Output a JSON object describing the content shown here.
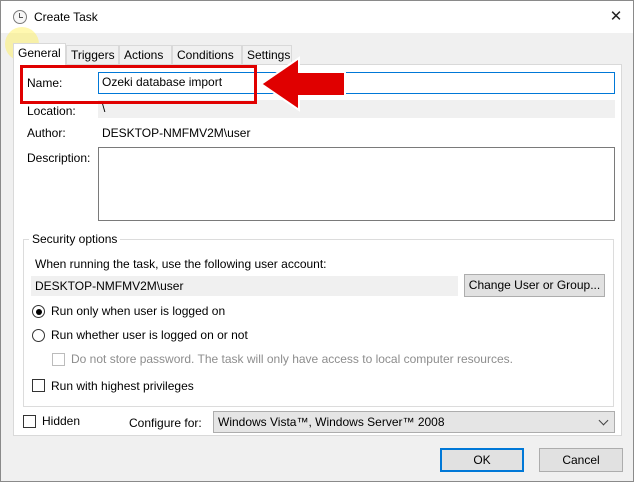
{
  "window": {
    "title": "Create Task",
    "close_label": "✕"
  },
  "tabs": [
    {
      "label": "General",
      "active": true
    },
    {
      "label": "Triggers",
      "active": false
    },
    {
      "label": "Actions",
      "active": false
    },
    {
      "label": "Conditions",
      "active": false
    },
    {
      "label": "Settings",
      "active": false
    }
  ],
  "general": {
    "name_label": "Name:",
    "name_value": "Ozeki database import",
    "location_label": "Location:",
    "location_value": "\\",
    "author_label": "Author:",
    "author_value": "DESKTOP-NMFMV2M\\user",
    "description_label": "Description:",
    "description_value": ""
  },
  "security": {
    "legend": "Security options",
    "account_prompt": "When running the task, use the following user account:",
    "account_value": "DESKTOP-NMFMV2M\\user",
    "change_button": "Change User or Group...",
    "radio_logged_on": "Run only when user is logged on",
    "radio_logged_on_checked": true,
    "radio_whether": "Run whether user is logged on or not",
    "radio_whether_checked": false,
    "no_store_password": "Do not store password.  The task will only have access to local computer resources.",
    "highest_privileges": "Run with highest privileges"
  },
  "bottom": {
    "hidden_label": "Hidden",
    "configure_label": "Configure for:",
    "configure_value": "Windows Vista™, Windows Server™ 2008"
  },
  "buttons": {
    "ok": "OK",
    "cancel": "Cancel"
  },
  "annotation": {
    "color": "#e00000"
  }
}
